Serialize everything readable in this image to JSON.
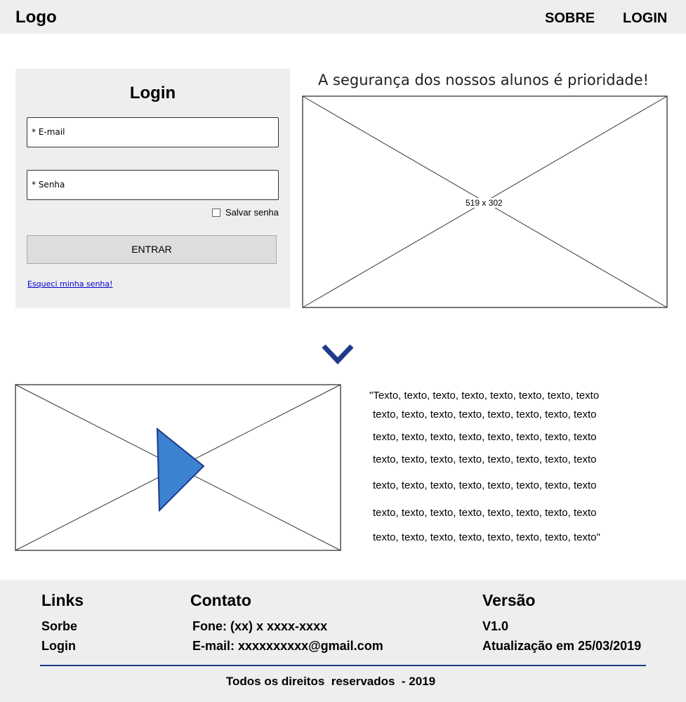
{
  "header": {
    "logo": "Logo",
    "nav": [
      {
        "label": "SOBRE"
      },
      {
        "label": "LOGIN"
      }
    ]
  },
  "login_form": {
    "title": "Login",
    "email_placeholder": "* E-mail",
    "password_placeholder": "* Senha",
    "remember_label": "Salvar senha",
    "remember_checked": false,
    "submit_label": "ENTRAR",
    "forgot_link": "Esqueci minha senha!"
  },
  "hero": {
    "headline": "A segurança dos nossos alunos é prioridade!",
    "image_placeholder_label": "519 x 302"
  },
  "scroll_indicator": {
    "icon": "chevron-down-icon",
    "color": "#1f3a8a"
  },
  "video": {
    "icon": "play-icon",
    "play_color": "#3b82d0"
  },
  "quote_lines": [
    "\"Texto, texto, texto, texto, texto, texto, texto, texto",
    "texto, texto, texto, texto, texto, texto, texto, texto",
    "texto, texto, texto, texto, texto, texto, texto, texto",
    "texto, texto, texto, texto, texto, texto, texto, texto",
    "texto, texto, texto, texto, texto, texto, texto, texto",
    "texto, texto, texto, texto, texto, texto, texto, texto",
    "texto, texto, texto, texto, texto, texto, texto, texto\""
  ],
  "footer": {
    "links": {
      "heading": "Links",
      "items": [
        "Sorbe",
        "Login"
      ]
    },
    "contact": {
      "heading": "Contato",
      "phone": "Fone: (xx) x xxxx-xxxx",
      "email": "E-mail: xxxxxxxxxx@gmail.com"
    },
    "version": {
      "heading": "Versão",
      "number": "V1.0",
      "updated": "Atualização em 25/03/2019"
    },
    "copyright": "Todos os direitos  reservados  - 2019",
    "accent": "#1f3a8a"
  }
}
